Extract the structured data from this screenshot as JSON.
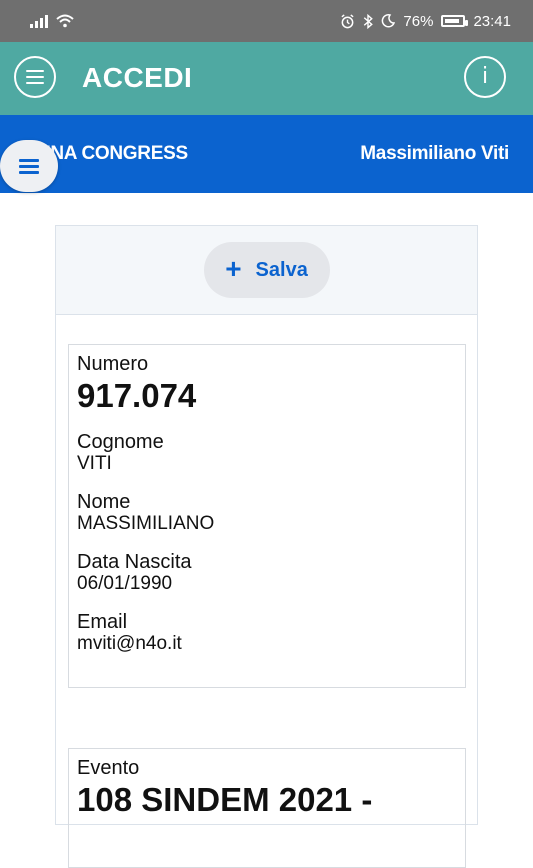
{
  "status_bar": {
    "battery": "76%",
    "time": "23:41",
    "icons": [
      "signal-icon",
      "wifi-icon",
      "alarm-icon",
      "bluetooth-icon",
      "moon-icon",
      "battery-icon"
    ]
  },
  "app_bar": {
    "title": "ACCEDI",
    "menu_icon": "hamburger-icon",
    "info_icon": "info-icon",
    "info_glyph": "i",
    "color": "#4fa9a2"
  },
  "subheader": {
    "left_text": "ENA CONGRESS",
    "user_name": "Massimiliano Viti",
    "color": "#0b63cf"
  },
  "card": {
    "save_label": "Salva",
    "save_icon": "plus-icon",
    "plus_glyph": "+",
    "fields": [
      {
        "label": "Numero",
        "value": "917.074"
      },
      {
        "label": "Cognome",
        "value": "VITI"
      },
      {
        "label": "Nome",
        "value": "MASSIMILIANO"
      },
      {
        "label": "Data Nascita",
        "value": "06/01/1990"
      },
      {
        "label": "Email",
        "value": "mviti@n4o.it"
      }
    ],
    "event": {
      "label": "Evento",
      "value": "108 SINDEM 2021 -"
    }
  }
}
